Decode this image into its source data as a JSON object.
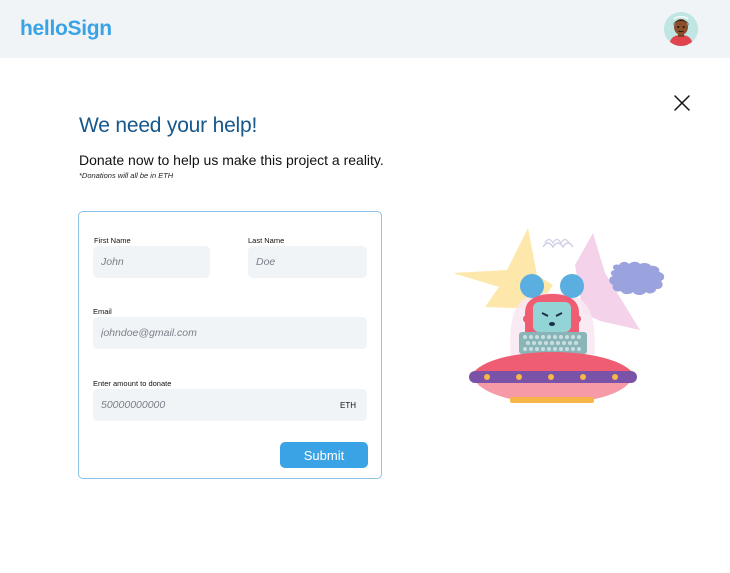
{
  "header": {
    "logo": "helloSign",
    "avatar_icon": "user-avatar"
  },
  "dialog": {
    "close_icon": "close-icon",
    "title": "We need your help!",
    "subtitle": "Donate now to help us make this project a reality.",
    "footnote": "*Donations will all be in ETH"
  },
  "form": {
    "first_name": {
      "label": "First Name",
      "placeholder": "John"
    },
    "last_name": {
      "label": "Last Name",
      "placeholder": "Doe"
    },
    "email": {
      "label": "Email",
      "placeholder": "johndoe@gmail.com"
    },
    "amount": {
      "label": "Enter amount to donate",
      "placeholder": "50000000000",
      "suffix": "ETH"
    },
    "submit_label": "Submit"
  },
  "colors": {
    "brand": "#3aa3e6",
    "heading": "#16578c",
    "field_bg": "#f1f4f7",
    "card_border": "#8cc3e8"
  }
}
